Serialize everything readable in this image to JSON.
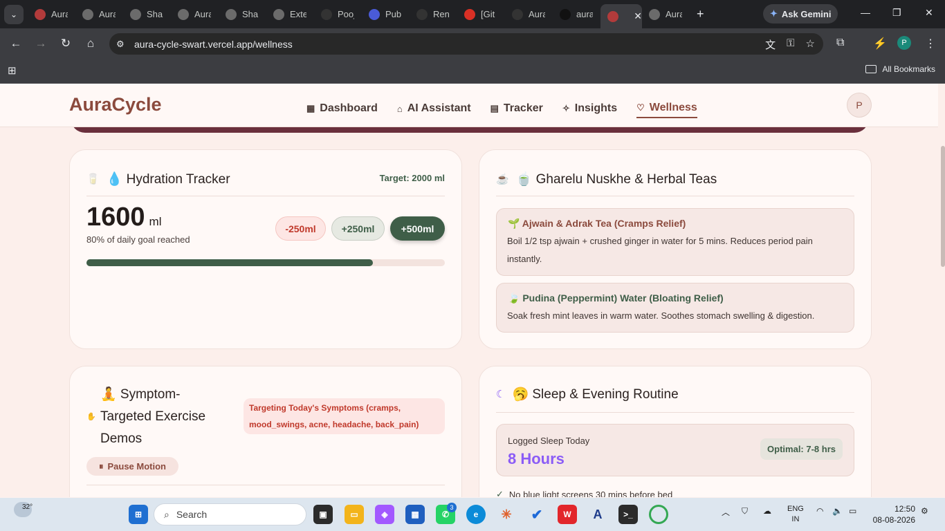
{
  "browser": {
    "tabs": [
      {
        "title": "Aura",
        "fav_color": "#b23b3b"
      },
      {
        "title": "Aura",
        "fav_color": "#6b6b6b"
      },
      {
        "title": "Shar",
        "fav_color": "#6b6b6b"
      },
      {
        "title": "Aura",
        "fav_color": "#6b6b6b"
      },
      {
        "title": "Shar",
        "fav_color": "#6b6b6b"
      },
      {
        "title": "Exte",
        "fav_color": "#6b6b6b"
      },
      {
        "title": "Pooj",
        "fav_color": "#333333"
      },
      {
        "title": "Publ",
        "fav_color": "#4a5bd8"
      },
      {
        "title": "Rend",
        "fav_color": "#333333"
      },
      {
        "title": "[Git",
        "fav_color": "#d93025"
      },
      {
        "title": "Aura",
        "fav_color": "#333333"
      },
      {
        "title": "aura",
        "fav_color": "#111111"
      },
      {
        "title": "",
        "fav_color": "#b23b3b"
      },
      {
        "title": "Aura",
        "fav_color": "#6b6b6b"
      }
    ],
    "gemini_label": "Ask Gemini",
    "url": "aura-cycle-swart.vercel.app/wellness",
    "profile_initial": "P",
    "bookmarks_label": "All Bookmarks"
  },
  "app": {
    "logo": "AuraCycle",
    "nav": [
      {
        "label": "Dashboard",
        "icon": "dashboard-icon"
      },
      {
        "label": "AI Assistant",
        "icon": "bot-icon"
      },
      {
        "label": "Tracker",
        "icon": "calendar-icon"
      },
      {
        "label": "Insights",
        "icon": "sparkle-icon"
      },
      {
        "label": "Wellness",
        "icon": "heart-icon"
      }
    ],
    "active_nav": "Wellness",
    "avatar_initial": "P"
  },
  "hydration": {
    "title": "💧 Hydration Tracker",
    "target": "Target: 2000 ml",
    "amount": "1600",
    "unit": "ml",
    "progress_text": "80% of daily goal reached",
    "progress": 0.8,
    "buttons": [
      "-250ml",
      "+250ml",
      "+500ml"
    ]
  },
  "remedies": {
    "title": "🍵 Gharelu Nuskhe & Herbal Teas",
    "items": [
      {
        "title": "🌱 Ajwain & Adrak Tea (Cramps Relief)",
        "desc": "Boil 1/2 tsp ajwain + crushed ginger in water for 5 mins. Reduces period pain instantly.",
        "color": "#8b4a3d"
      },
      {
        "title": "🍃 Pudina (Peppermint) Water (Bloating Relief)",
        "desc": "Soak fresh mint leaves in warm water. Soothes stomach swelling & digestion.",
        "color": "#3f5e48"
      }
    ]
  },
  "exercise": {
    "title_line1": "🧘 Symptom-",
    "title_line2": "Targeted Exercise",
    "title_line3": "Demos",
    "targeting": "Targeting Today's Symptoms (cramps, mood_swings, acne, headache, back_pain)",
    "pause_label": "Pause Motion"
  },
  "sleep": {
    "title": "🥱 Sleep & Evening Routine",
    "logged_label": "Logged Sleep Today",
    "hours": "8 Hours",
    "optimal": "Optimal: 7-8 hrs",
    "tip": "No blue light screens 30 mins before bed"
  },
  "taskbar": {
    "weather": "32°",
    "search_placeholder": "Search",
    "whatsapp_badge": "3",
    "lang_line1": "ENG",
    "lang_line2": "IN",
    "time": "12:50",
    "date": "08-08-2026"
  }
}
